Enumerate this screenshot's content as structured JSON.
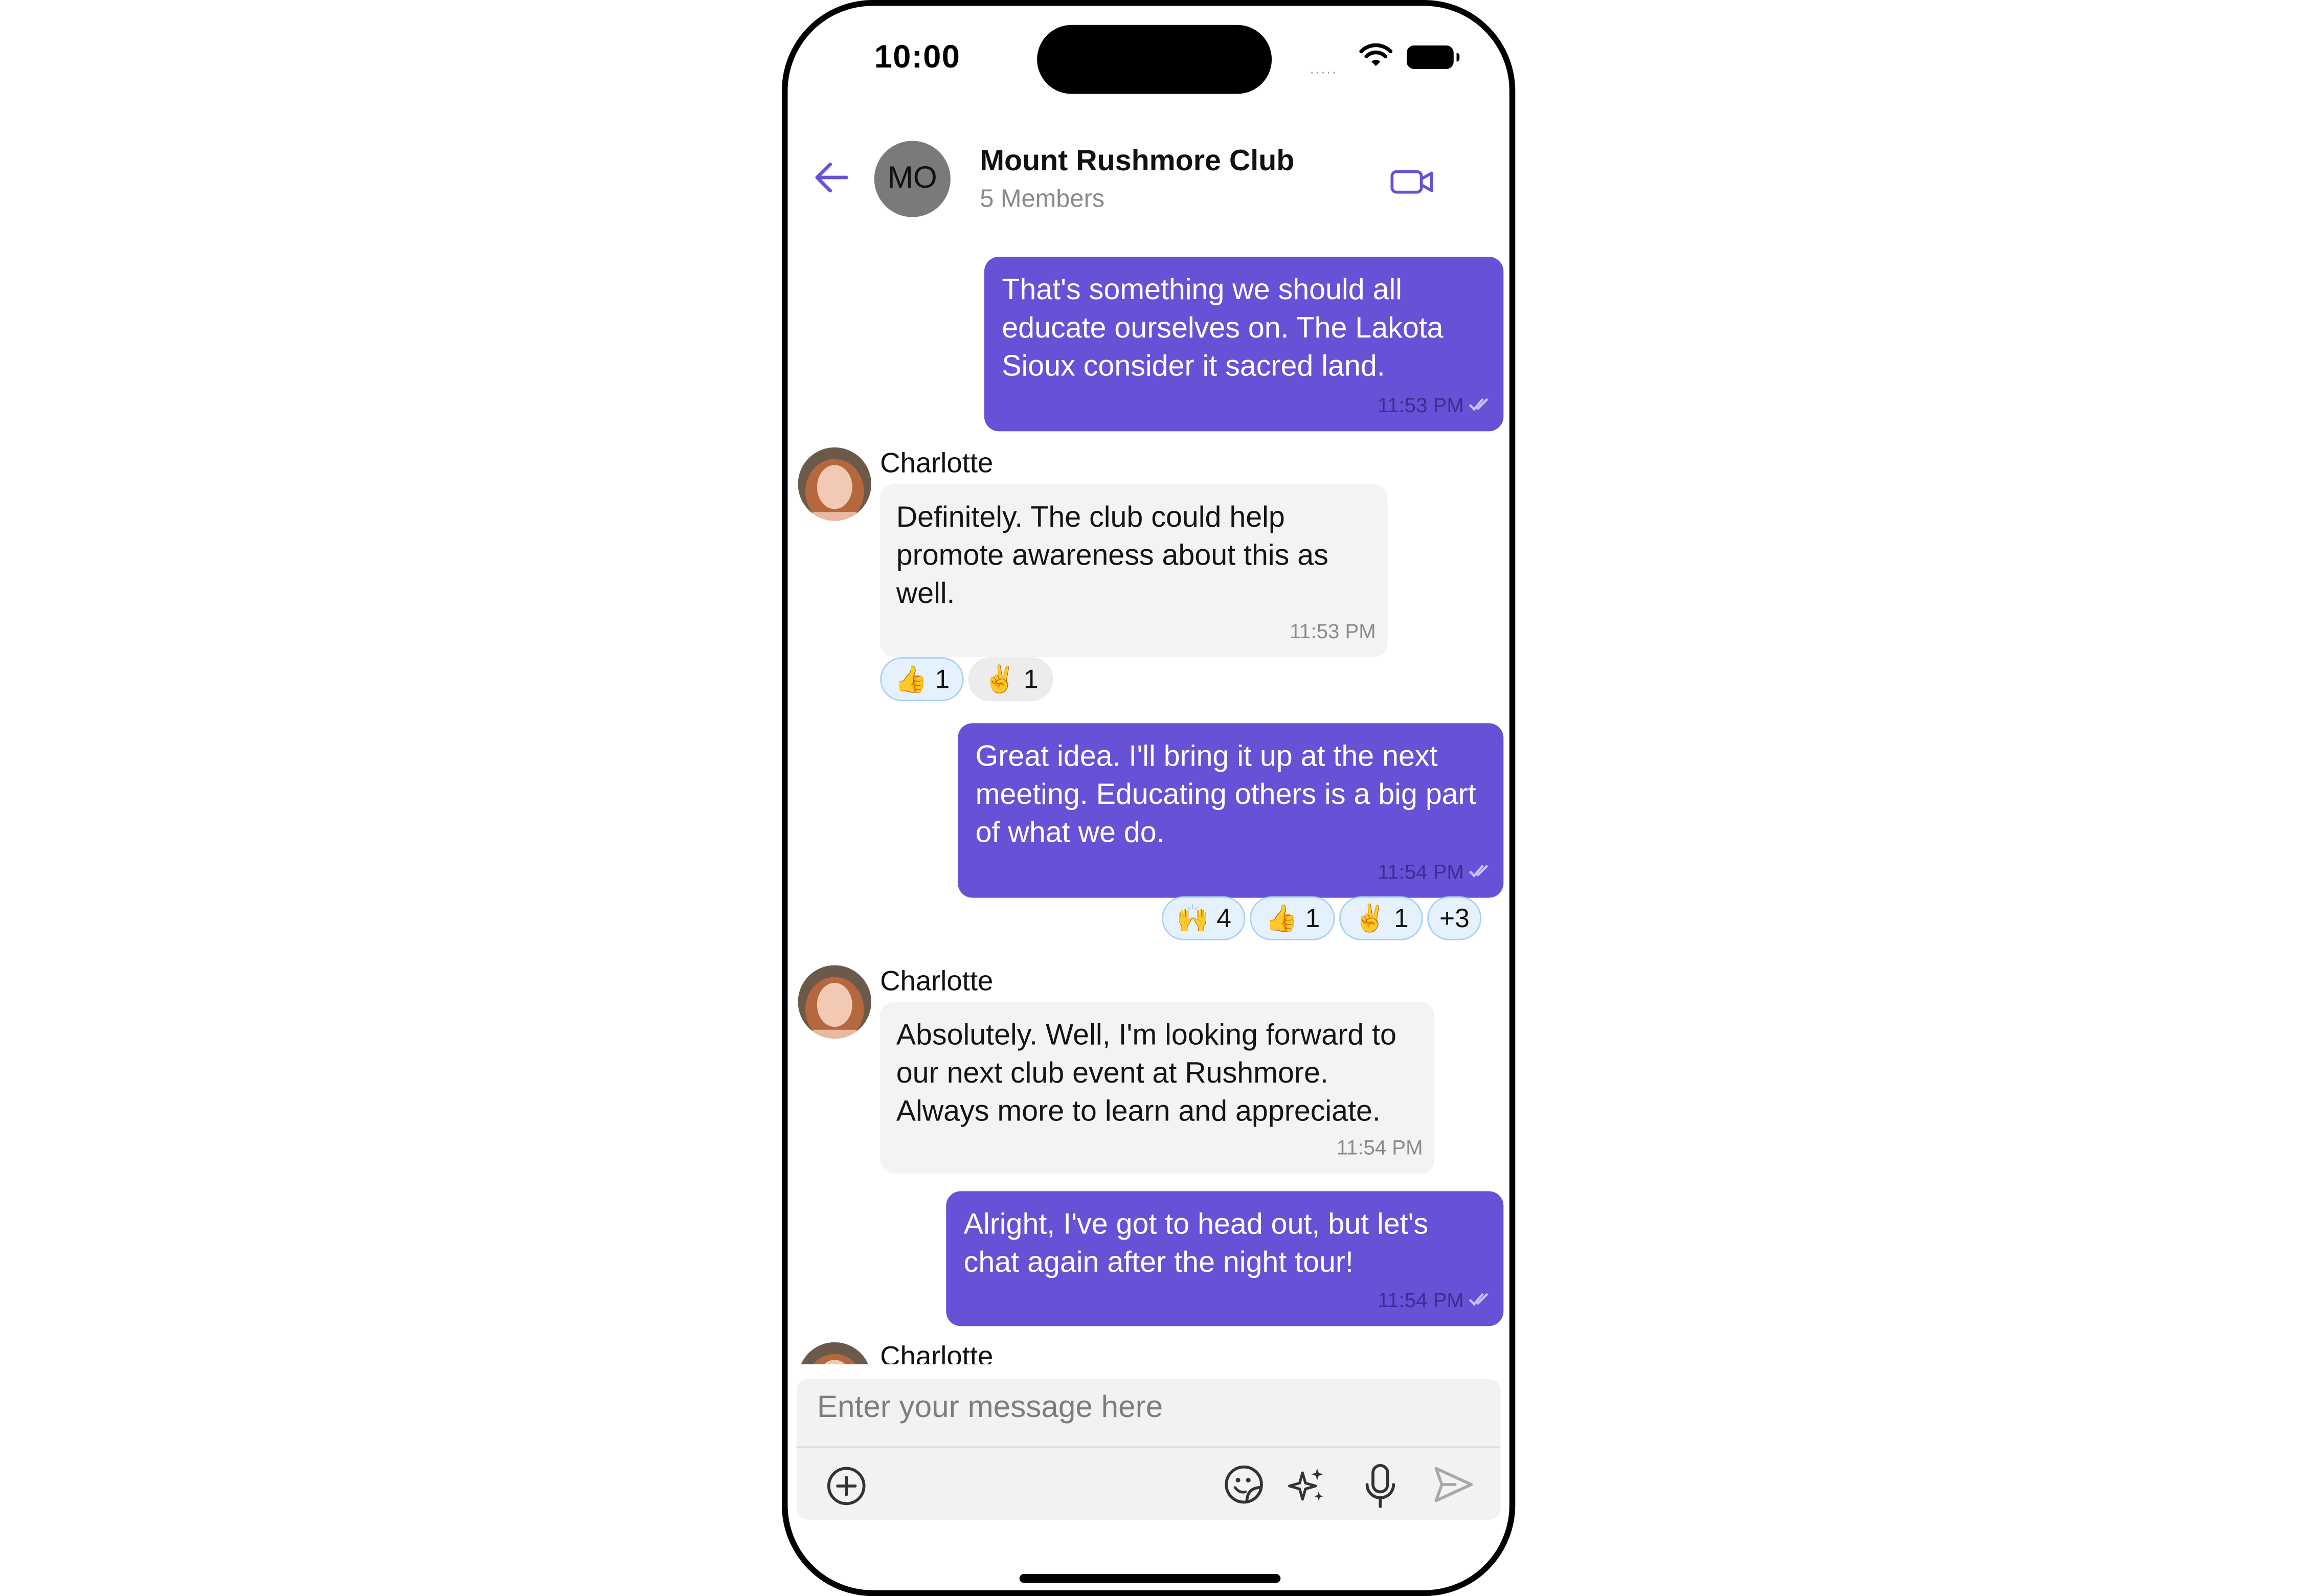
{
  "status_bar": {
    "time": "10:00",
    "dots": "....."
  },
  "header": {
    "avatar_initials": "MO",
    "title": "Mount Rushmore Club",
    "subtitle": "5 Members"
  },
  "colors": {
    "accent": "#6851d6",
    "incoming_bubble": "#f3f3f3",
    "reaction_selected": "#e5f2fd"
  },
  "messages": [
    {
      "direction": "outgoing",
      "text": "That's something we should all educate ourselves on. The Lakota Sioux consider it sacred land.",
      "time": "11:53 PM",
      "status_icon": "double-check-icon"
    },
    {
      "direction": "incoming",
      "sender": "Charlotte",
      "text": "Definitely. The club could help promote awareness about this as well.",
      "time": "11:53 PM",
      "reactions": [
        {
          "emoji": "👍",
          "count": "1",
          "selected": true
        },
        {
          "emoji": "✌️",
          "count": "1",
          "selected": false
        }
      ]
    },
    {
      "direction": "outgoing",
      "text": "Great idea. I'll bring it up at the next meeting. Educating others is a big part of what we do.",
      "time": "11:54 PM",
      "status_icon": "double-check-icon",
      "reactions": [
        {
          "emoji": "🙌",
          "count": "4"
        },
        {
          "emoji": "👍",
          "count": "1"
        },
        {
          "emoji": "✌️",
          "count": "1"
        },
        {
          "more": "+3"
        }
      ]
    },
    {
      "direction": "incoming",
      "sender": "Charlotte",
      "text": "Absolutely. Well, I'm looking forward to our next club event at Rushmore. Always more to learn and appreciate.",
      "time": "11:54 PM"
    },
    {
      "direction": "outgoing",
      "text": "Alright, I've got to head out, but let's chat again after the night tour!",
      "time": "11:54 PM",
      "status_icon": "double-check-icon"
    },
    {
      "direction": "incoming",
      "sender": "Charlotte",
      "partial": true
    }
  ],
  "composer": {
    "placeholder": "Enter your message here",
    "icons": [
      "add-attachment-icon",
      "sticker-icon",
      "ai-sparkle-icon",
      "microphone-icon",
      "send-icon"
    ]
  }
}
